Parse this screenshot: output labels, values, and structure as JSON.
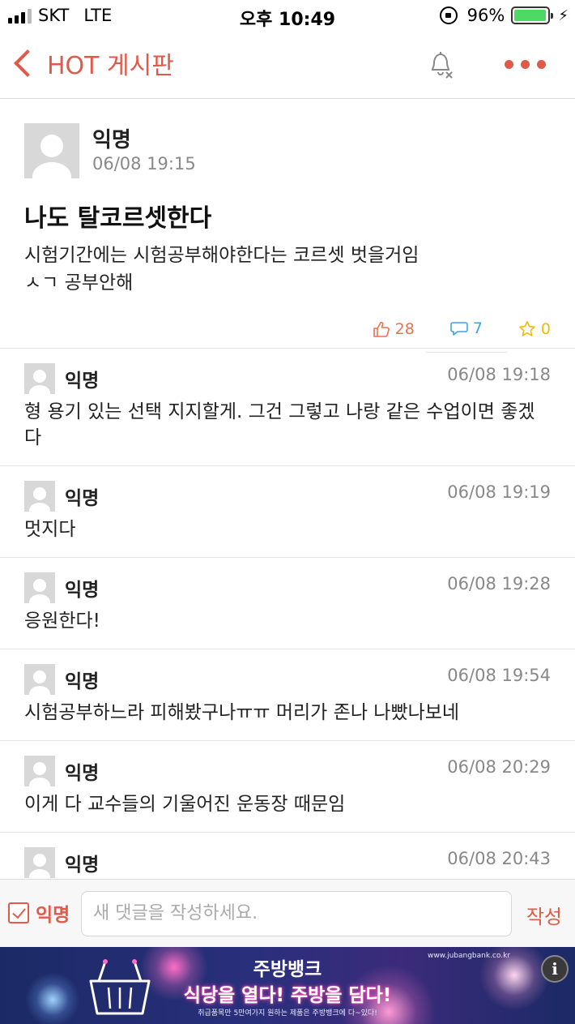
{
  "status": {
    "carrier": "SKT",
    "network": "LTE",
    "time": "오후 10:49",
    "battery": "96%",
    "battery_level": 0.96
  },
  "nav": {
    "back_label": "HOT 게시판",
    "icons": [
      "chevron-left-icon",
      "bell-off-icon",
      "more-icon"
    ]
  },
  "post": {
    "author": "익명",
    "date": "06/08 19:15",
    "title": "나도 탈코르셋한다",
    "body_lines": [
      "시험기간에는 시험공부해야한다는 코르셋 벗을거임",
      "ㅅㄱ 공부안해"
    ],
    "likes": "28",
    "comments": "7",
    "scraps": "0"
  },
  "comments": [
    {
      "author": "익명",
      "date": "06/08 19:18",
      "body": "형 용기 있는 선택 지지할게. 그건 그렇고 나랑 같은 수업이면 좋겠다"
    },
    {
      "author": "익명",
      "date": "06/08 19:19",
      "body": "멋지다"
    },
    {
      "author": "익명",
      "date": "06/08 19:28",
      "body": "응원한다!"
    },
    {
      "author": "익명",
      "date": "06/08 19:54",
      "body": "시험공부하느라 피해봤구나ㅠㅠ 머리가 존나 나빴나보네"
    },
    {
      "author": "익명",
      "date": "06/08 20:29",
      "body": "이게 다 교수들의 기울어진 운동장 때문임"
    },
    {
      "author": "익명",
      "date": "06/08 20:43",
      "body": ""
    }
  ],
  "compose": {
    "anonymous_label": "익명",
    "anonymous_checked": true,
    "placeholder": "새 댓글을 작성하세요.",
    "submit_label": "작성"
  },
  "ad": {
    "brand": "주방뱅크",
    "slogan": "식당을 열다! 주방을 담다!",
    "sub": "취급품목만 5만여가지 원하는 제품은 주방뱅크에 다~있다!",
    "url": "www.jubangbank.co.kr",
    "info_label": "i"
  },
  "colors": {
    "accent": "#e05a4a",
    "like": "#e8734f",
    "comment": "#3aa6d8",
    "scrap": "#f3b90b",
    "battery": "#4cd964"
  }
}
